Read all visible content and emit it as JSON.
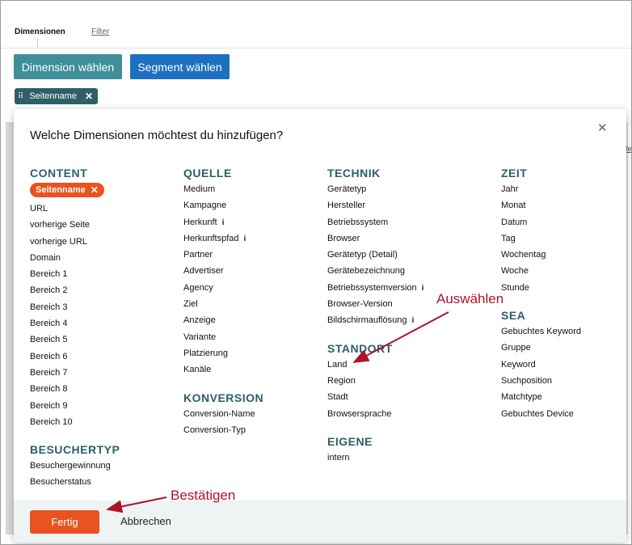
{
  "tabs": {
    "active": "Dimensionen",
    "filter": "Filter"
  },
  "buttons": {
    "dimension": "Dimension wählen",
    "segment": "Segment wählen"
  },
  "selected_chip": {
    "label": "Seitenname"
  },
  "modal": {
    "title": "Welche Dimensionen möchtest du hinzufügen?",
    "columns": [
      {
        "sections": [
          {
            "heading": "CONTENT",
            "chip": "Seitenname",
            "items": [
              "URL",
              "vorherige Seite",
              "vorherige URL",
              "Domain",
              "Bereich 1",
              "Bereich 2",
              "Bereich 3",
              "Bereich 4",
              "Bereich 5",
              "Bereich 6",
              "Bereich 7",
              "Bereich 8",
              "Bereich 9",
              "Bereich 10"
            ]
          },
          {
            "heading": "BESUCHERTYP",
            "items": [
              "Besuchergewinnung",
              "Besucherstatus"
            ]
          }
        ]
      },
      {
        "sections": [
          {
            "heading": "QUELLE",
            "items": [
              "Medium",
              "Kampagne",
              "Herkunft",
              "Herkunftspfad",
              "Partner",
              "Advertiser",
              "Agency",
              "Ziel",
              "Anzeige",
              "Variante",
              "Platzierung",
              "Kanäle"
            ]
          },
          {
            "heading": "KONVERSION",
            "items": [
              "Conversion-Name",
              "Conversion-Typ"
            ]
          }
        ]
      },
      {
        "sections": [
          {
            "heading": "TECHNIK",
            "items": [
              "Gerätetyp",
              "Hersteller",
              "Betriebssystem",
              "Browser",
              "Gerätetyp (Detail)",
              "Gerätebezeichnung",
              "Betriebssystemversion",
              "Browser-Version",
              "Bildschirmauflösung"
            ]
          },
          {
            "heading": "STANDORT",
            "items": [
              "Land",
              "Region",
              "Stadt",
              "Browsersprache"
            ]
          },
          {
            "heading": "EIGENE",
            "items": [
              "intern"
            ]
          }
        ]
      },
      {
        "sections": [
          {
            "heading": "ZEIT",
            "items": [
              "Jahr",
              "Monat",
              "Datum",
              "Tag",
              "Wochentag",
              "Woche",
              "Stunde"
            ]
          },
          {
            "heading": "SEA",
            "items": [
              "Gebuchtes Keyword",
              "Gruppe",
              "Keyword",
              "Suchposition",
              "Matchtype",
              "Gebuchtes Device"
            ]
          }
        ]
      }
    ],
    "footer": {
      "confirm": "Fertig",
      "cancel": "Abbrechen"
    }
  },
  "annotations": {
    "select": "Auswählen",
    "confirm": "Bestätigen"
  },
  "colors": {
    "accent": "#e9531f",
    "heading": "#2d5f69",
    "annotation": "#b0122b"
  }
}
